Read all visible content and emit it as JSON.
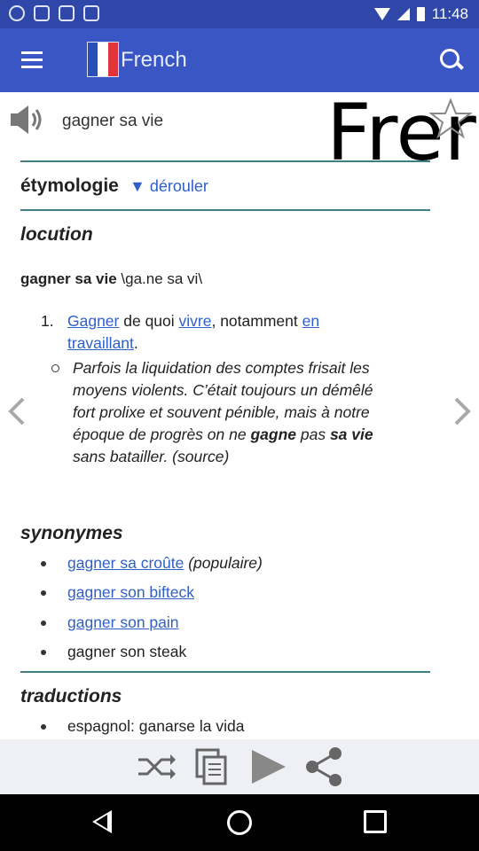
{
  "status": {
    "time": "11:48"
  },
  "appbar": {
    "title": "French"
  },
  "word": {
    "text": "gagner sa vie",
    "big_banner": "Frer"
  },
  "etymology": {
    "label": "étymologie",
    "toggle": "▼ dérouler"
  },
  "locution": {
    "heading": "locution",
    "entry_word": "gagner sa vie",
    "pronunciation": " \\ga.ne sa vi\\",
    "definitions": [
      {
        "number": "1.",
        "parts": [
          {
            "text": "Gagner",
            "link": true
          },
          {
            "text": " de quoi ",
            "link": false
          },
          {
            "text": "vivre",
            "link": true
          },
          {
            "text": ", notamment ",
            "link": false
          },
          {
            "text": "en travaillant",
            "link": true
          },
          {
            "text": ".",
            "link": false
          }
        ],
        "example": {
          "before": "Parfois la liquidation des comptes frisait les moyens violents. C’était toujours un démêlé fort prolixe et souvent pénible, mais à notre époque de progrès on ne ",
          "bold1": "gagne",
          "middle": " pas ",
          "bold2": "sa vie",
          "after": " sans batailler. (source)"
        }
      }
    ]
  },
  "synonymes": {
    "heading": "synonymes",
    "items": [
      {
        "link": "gagner sa croûte",
        "note": " (populaire)"
      },
      {
        "link": "gagner son bifteck",
        "note": ""
      },
      {
        "link": "gagner son pain",
        "note": ""
      },
      {
        "link": "",
        "note": "gagner son steak"
      }
    ]
  },
  "traductions": {
    "heading": "traductions",
    "items": [
      "espagnol: ganarse la vida"
    ]
  },
  "colors": {
    "appbar": "#3a55c4",
    "statusbar": "#2f47a8",
    "link": "#2f5fc9",
    "divider": "#3f7f83"
  }
}
